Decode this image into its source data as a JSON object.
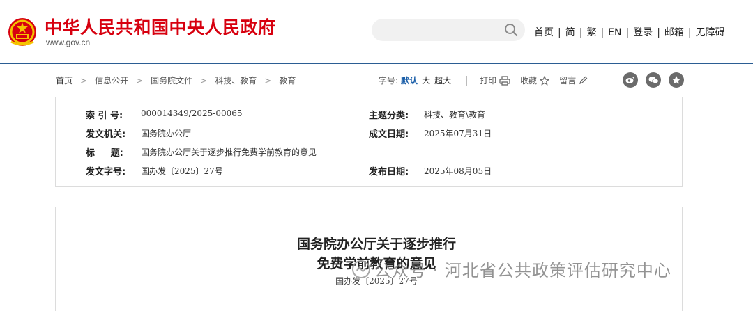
{
  "header": {
    "site_title": "中华人民共和国中央人民政府",
    "site_url": "www.gov.cn",
    "emblem_icon": "national-emblem-icon",
    "brand_color": "#d7000f",
    "search": {
      "value": "",
      "icon": "search-icon"
    },
    "links": [
      "首页",
      "简",
      "繁",
      "EN",
      "登录",
      "邮箱",
      "无障碍"
    ]
  },
  "breadcrumb": [
    "首页",
    "信息公开",
    "国务院文件",
    "科技、教育",
    "教育"
  ],
  "tools": {
    "font_size_label": "字号:",
    "font_sizes": [
      "默认",
      "大",
      "超大"
    ],
    "print_label": "打印",
    "favorite_label": "收藏",
    "comment_label": "留言",
    "social_icons": [
      "weibo-icon",
      "wechat-icon",
      "star-icon"
    ]
  },
  "info": {
    "index_label": "索 引 号:",
    "index_value": "000014349/2025-00065",
    "topic_label": "主题分类:",
    "topic_value": "科技、教育\\教育",
    "issuer_label": "发文机关:",
    "issuer_value": "国务院办公厅",
    "written_date_label": "成文日期:",
    "written_date_value": "2025年07月31日",
    "title_label": "标     题:",
    "title_value": "国务院办公厅关于逐步推行免费学前教育的意见",
    "doc_no_label": "发文字号:",
    "doc_no_value": "国办发〔2025〕27号",
    "publish_date_label": "发布日期:",
    "publish_date_value": "2025年08月05日"
  },
  "document": {
    "title_line1": "国务院办公厅关于逐步推行",
    "title_line2": "免费学前教育的意见",
    "number": "国办发〔2025〕27号"
  },
  "watermark": {
    "text": "公众号 · 河北省公共政策评估研究中心",
    "icon": "wechat-official-account-icon"
  }
}
